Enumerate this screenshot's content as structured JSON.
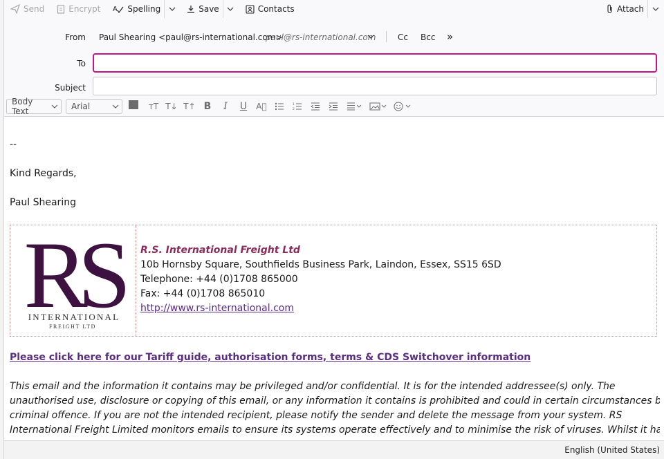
{
  "toolbar": {
    "send": "Send",
    "encrypt": "Encrypt",
    "spelling": "Spelling",
    "save": "Save",
    "contacts": "Contacts",
    "attach": "Attach"
  },
  "header": {
    "from_label": "From",
    "from_name": "Paul Shearing <paul@rs-international.com>",
    "from_identity": "paul@rs-international.com",
    "cc": "Cc",
    "bcc": "Bcc",
    "more": "»",
    "to_label": "To",
    "to_value": "",
    "subject_label": "Subject",
    "subject_value": ""
  },
  "format_bar": {
    "paragraph_style": "Body Text",
    "font": "Arial"
  },
  "message": {
    "sig_dashes": "--",
    "regards": "Kind Regards,",
    "name": "Paul Shearing",
    "logo_letters": "RS",
    "logo_line1": "INTERNATIONAL",
    "logo_line2": "FREIGHT LTD",
    "company": "R.S. International Freight Ltd",
    "address": "10b Hornsby Square, Southfields Business Park, Laindon, Essex, SS15 6SD",
    "telephone": "Telephone: +44 (0)1708 865000",
    "fax": "Fax: +44 (0)1708 865010",
    "website": "http://www.rs-international.com",
    "tariff_link": "Please click here for our Tariff guide, authorisation forms, terms & CDS Switchover information",
    "disclaimer_lines": [
      "This email and the information it contains may be privileged and/or confidential. It is for the intended addressee(s) only. The",
      "unauthorised use, disclosure or copying of this email, or any information it contains is prohibited and could in certain circumstances be a",
      "criminal offence. If you are not the intended recipient, please notify the sender and delete the message from your system. RS",
      "International Freight Limited monitors emails to ensure its systems operate effectively and to minimise the risk of viruses. Whilst it has"
    ]
  },
  "status_bar": {
    "language": "English (United States)"
  },
  "colors": {
    "accent_focus": "#c0168a",
    "logo_purple": "#3d1240",
    "company_text": "#8b2c5c",
    "link": "#5b2c83"
  }
}
